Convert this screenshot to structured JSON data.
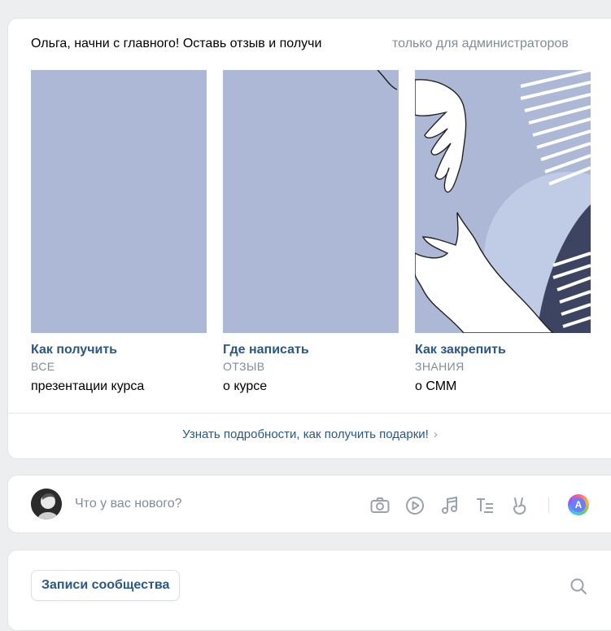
{
  "promo": {
    "title": "Ольга, начни с главного! Оставь отзыв и получи",
    "admin_note": "только для администраторов",
    "tiles": [
      {
        "title": "Как получить",
        "caption": "ВСЕ",
        "subtitle": "презентации курса"
      },
      {
        "title": "Где написать",
        "caption": "ОТЗЫВ",
        "subtitle": "о курсе"
      },
      {
        "title": "Как закрепить",
        "caption": "ЗНАНИЯ",
        "subtitle": "о СММ"
      }
    ],
    "more_link": "Узнать подробности, как получить подарки!",
    "more_chevron": "›"
  },
  "composer": {
    "placeholder": "Что у вас нового?",
    "icons": [
      "camera-icon",
      "video-play-icon",
      "music-note-icon",
      "text-format-icon",
      "peace-hand-icon"
    ],
    "ai_label": "A"
  },
  "wall": {
    "tab_label": "Записи сообщества"
  },
  "colors": {
    "link": "#2a5885",
    "muted": "#818c99",
    "tile_bg": "#adb8d6",
    "page_bg": "#edeef0"
  }
}
